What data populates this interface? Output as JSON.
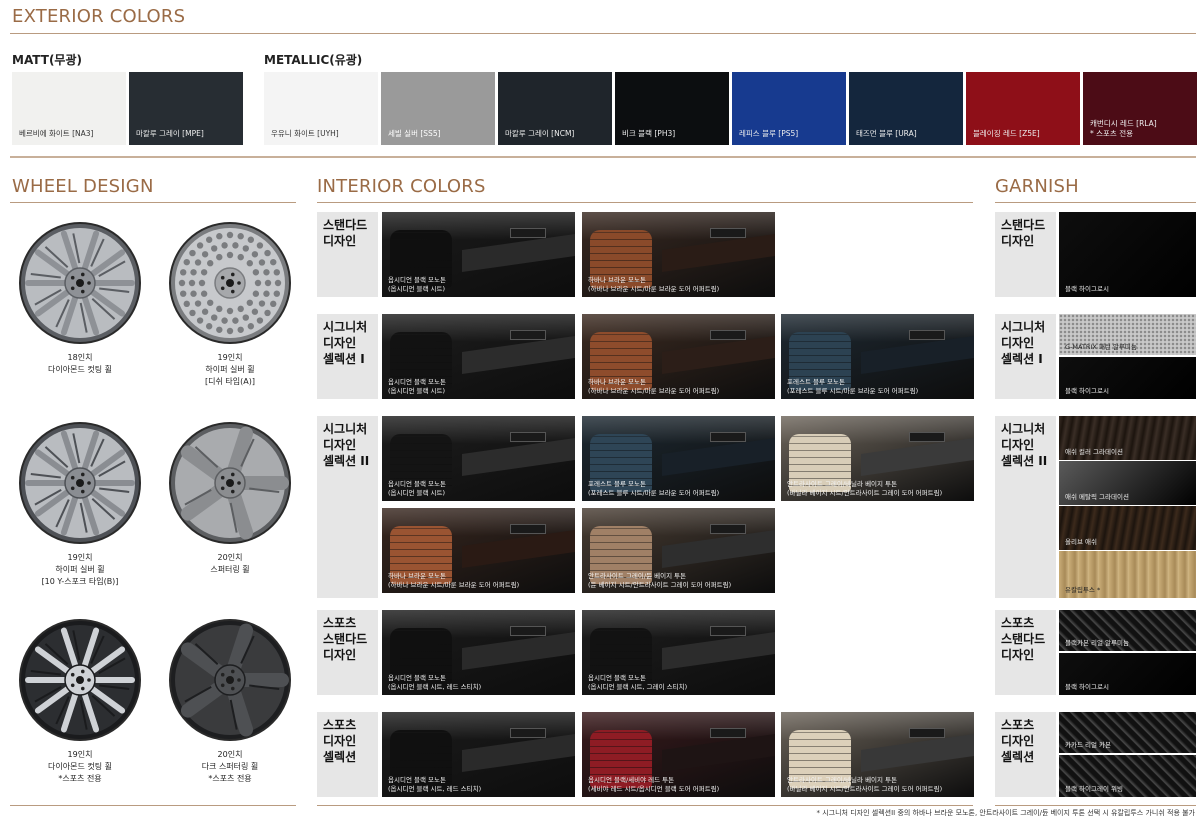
{
  "exterior": {
    "title": "EXTERIOR COLORS",
    "matt_title": "MATT(무광)",
    "metallic_title": "METALLIC(유광)",
    "matt": [
      {
        "label": "베르비에 화이트 [NA3]",
        "color": "#f1f1ef",
        "text_color": "#333333"
      },
      {
        "label": "마칼루 그레이 [MPE]",
        "color": "#272d33",
        "text_color": "#eeeeee"
      }
    ],
    "metallic": [
      {
        "label": "우유니 화이트 [UYH]",
        "color": "#f4f4f4",
        "text_color": "#333333"
      },
      {
        "label": "세빌 실버 [SS5]",
        "color": "#9a9a9a",
        "text_color": "#ffffff"
      },
      {
        "label": "마칼루 그레이 [NCM]",
        "color": "#1f252b",
        "text_color": "#eeeeee"
      },
      {
        "label": "비크 블랙 [PH3]",
        "color": "#0c0e10",
        "text_color": "#eeeeee"
      },
      {
        "label": "레피스 블루 [PS5]",
        "color": "#173a8f",
        "text_color": "#eeeeee"
      },
      {
        "label": "태즈먼 블루 [URA]",
        "color": "#14263d",
        "text_color": "#eeeeee"
      },
      {
        "label": "블레이징 레드 [Z5E]",
        "color": "#8e0f18",
        "text_color": "#eeeeee"
      },
      {
        "label": "캐번디시 레드 [RLA]",
        "label2": "* 스포츠 전용",
        "color": "#4c0c16",
        "text_color": "#eeeeee"
      }
    ]
  },
  "wheels": {
    "title": "WHEEL DESIGN",
    "items": [
      {
        "line1": "18인치",
        "line2": "다이아몬드 컷팅 휠",
        "line3": ""
      },
      {
        "line1": "19인치",
        "line2": "하이퍼 실버 휠",
        "line3": "[디쉬 타입(A)]"
      },
      {
        "line1": "19인치",
        "line2": "하이퍼 실버 휠",
        "line3": "[10 Y-스포크 타입(B)]"
      },
      {
        "line1": "20인치",
        "line2": "스퍼터링 휠",
        "line3": ""
      },
      {
        "line1": "19인치",
        "line2": "다이아몬드 컷팅 휠",
        "line3": "*스포츠 전용"
      },
      {
        "line1": "20인치",
        "line2": "다크 스퍼터링 휠",
        "line3": "*스포츠 전용"
      }
    ]
  },
  "interior": {
    "title": "INTERIOR COLORS",
    "rows": [
      {
        "label": "스탠다드\n디자인"
      },
      {
        "label": "시그니처\n디자인\n셀렉션 I"
      },
      {
        "label": "시그니처\n디자인\n셀렉션 II"
      },
      {
        "label": "스포츠\n스탠다드\n디자인"
      },
      {
        "label": "스포츠\n디자인\n셀렉션"
      }
    ],
    "photos": [
      {
        "line1": "옵시디언 블랙 모노톤",
        "line2": "(옵시디언 블랙 시트)",
        "base": "#1c1c1c",
        "seat": "#0f0f0f",
        "dash": "#2a2a2a"
      },
      {
        "line1": "하바나 브라운 모노톤",
        "line2": "(하바나 브라운 시트/마룬 브라운 도어 어퍼트림)",
        "base": "#3a2a22",
        "seat": "#8a4a2a",
        "dash": "#2a1c16"
      },
      {
        "line1": "옵시디언 블랙 모노톤",
        "line2": "(옵시디언 블랙 시트)",
        "base": "#1e1e1e",
        "seat": "#121212",
        "dash": "#2c2c2c"
      },
      {
        "line1": "하바나 브라운 모노톤",
        "line2": "(하바나 브라운 시트/마룬 브라운 도어 어퍼트림)",
        "base": "#3e2c22",
        "seat": "#8e4c2c",
        "dash": "#2c1e18"
      },
      {
        "line1": "포레스트 블루 모노톤",
        "line2": "(포레스트 블루 시트/마룬 브라운 도어 어퍼트림)",
        "base": "#1f2a33",
        "seat": "#2c4252",
        "dash": "#182028"
      },
      {
        "line1": "옵시디언 블랙 모노톤",
        "line2": "(옵시디언 블랙 시트)",
        "base": "#1e1e1e",
        "seat": "#141414",
        "dash": "#2c2c2c"
      },
      {
        "line1": "포레스트 블루 모노톤",
        "line2": "(포레스트 블루 시트/마룬 브라운 도어 어퍼트림)",
        "base": "#1e2a33",
        "seat": "#2e4556",
        "dash": "#182028"
      },
      {
        "line1": "안트라사이트 그레이/바닐라 베이지 투톤",
        "line2": "(바닐라 베이지 시트/안트라사이트 그레이 도어 어퍼트림)",
        "base": "#6e665c",
        "seat": "#d8cdb8",
        "dash": "#3a3a3a"
      },
      {
        "line1": "하바나 브라운 모노톤",
        "line2": "(하바나 브라운 시트/마룬 브라운 도어 어퍼트림)",
        "base": "#3a2820",
        "seat": "#9a5432",
        "dash": "#2a1a14"
      },
      {
        "line1": "안트라사이트 그레이/듄 베이지 투톤",
        "line2": "(듄 베이지 시트/안트라사이트 그레이 도어 어퍼트림)",
        "base": "#4a3e34",
        "seat": "#a08066",
        "dash": "#2e2e2e"
      },
      {
        "line1": "옵시디언 블랙 모노톤",
        "line2": "(옵시디언 블랙 시트, 레드 스티치)",
        "base": "#1c1c1c",
        "seat": "#101010",
        "dash": "#2a2a2a"
      },
      {
        "line1": "옵시디언 블랙 모노톤",
        "line2": "(옵시디언 블랙 시트, 그레이 스티치)",
        "base": "#1e1e1e",
        "seat": "#121212",
        "dash": "#2c2c2c"
      },
      {
        "line1": "옵시디언 블랙 모노톤",
        "line2": "(옵시디언 블랙 시트, 레드 스티치)",
        "base": "#1c1c1c",
        "seat": "#101010",
        "dash": "#2a2a2a"
      },
      {
        "line1": "옵시디언 블랙/세비야 레드 투톤",
        "line2": "(세비야 레드 시트/옵시디언 블랙 도어 어퍼트림)",
        "base": "#3a1a1c",
        "seat": "#8e1c24",
        "dash": "#1e1414"
      },
      {
        "line1": "안트라사이트 그레이/바닐라 베이지 투톤",
        "line2": "(바닐라 베이지 시트/안트라사이트 그레이 도어 어퍼트림)",
        "base": "#6c645a",
        "seat": "#dcd0ba",
        "dash": "#383838"
      }
    ]
  },
  "garnish": {
    "title": "GARNISH",
    "rows": [
      {
        "label": "스탠다드\n디자인"
      },
      {
        "label": "시그니처\n디자인\n셀렉션 I"
      },
      {
        "label": "시그니처\n디자인\n셀렉션 II"
      },
      {
        "label": "스포츠\n스탠다드\n디자인"
      },
      {
        "label": "스포츠\n디자인\n셀렉션"
      }
    ],
    "tiles": [
      {
        "label": "블랙 하이그로시",
        "color": "#0e0e0e"
      },
      {
        "label": "G-MATRIX 패턴 알루미늄",
        "color": "#b8b8b8"
      },
      {
        "label": "블랙 하이그로시",
        "color": "#0e0e0e"
      },
      {
        "label": "애쉬 컬러 그라데이션",
        "color": "#3a2e26"
      },
      {
        "label": "애쉬 메탈릭 그라데이션",
        "color": "#5a5a5a"
      },
      {
        "label": "올리브 애쉬",
        "color": "#3c2a1c"
      },
      {
        "label": "유칼립투스 *",
        "color": "#b69a66"
      },
      {
        "label": "블랙카본 리얼 알루미늄",
        "color": "#222222"
      },
      {
        "label": "블랙 하이그로시",
        "color": "#0e0e0e"
      },
      {
        "label": "카카드 리얼 카본",
        "color": "#2a2a2a"
      },
      {
        "label": "블랙 하이그레이 위빙",
        "color": "#3a3a3a"
      }
    ]
  },
  "footnote": "* 시그니처 디자인 셀렉션II 중의 하바나 브라운 모노톤, 안트라사이트 그레이/듄 베이지 투톤 선택 시 유칼립투스 가니쉬 적용 불가"
}
